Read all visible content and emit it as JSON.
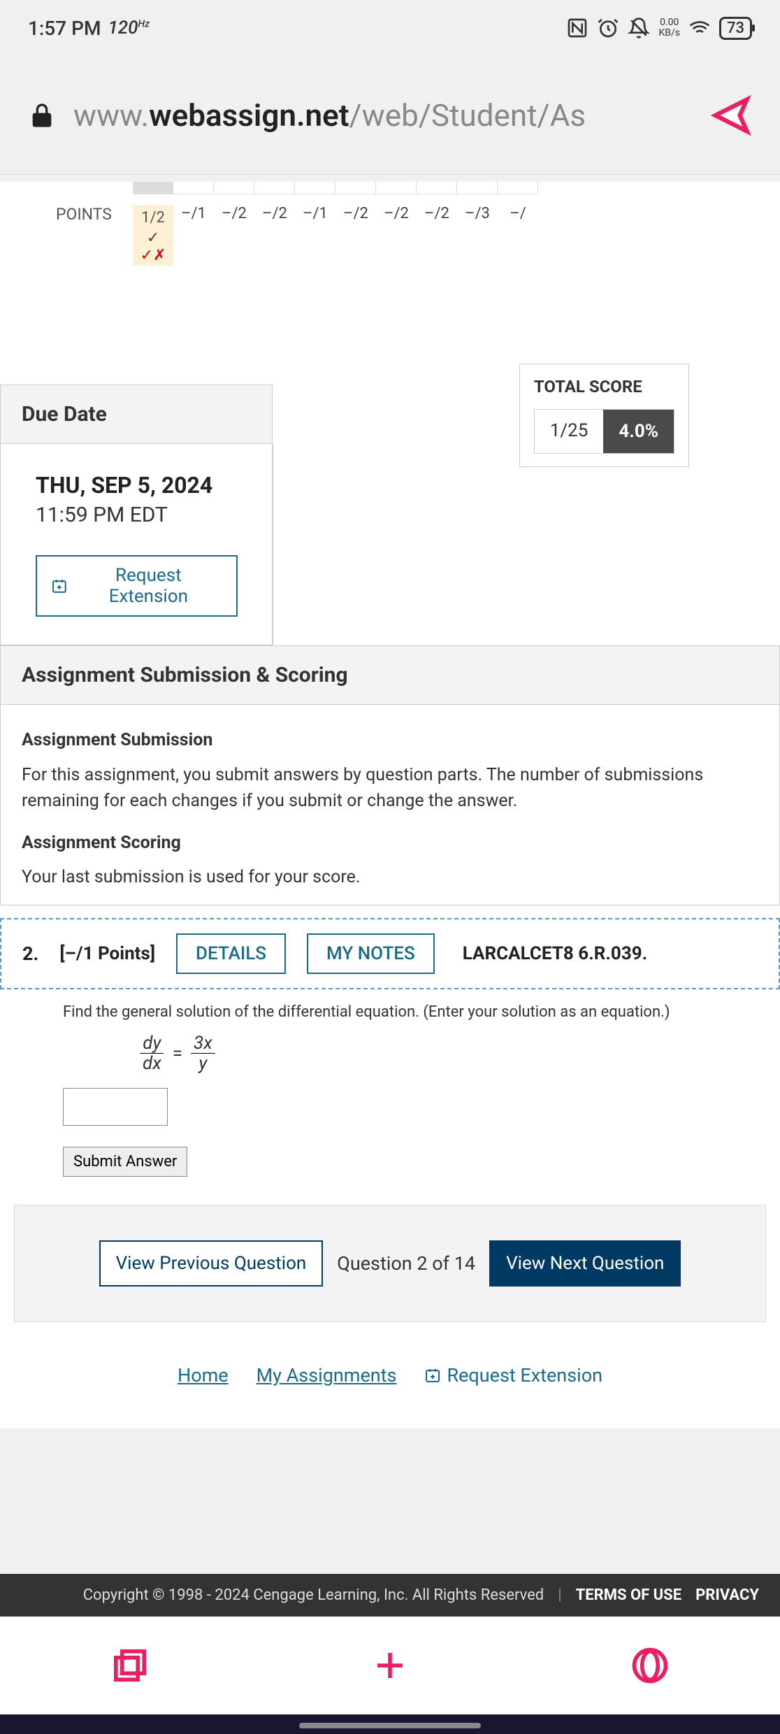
{
  "status": {
    "time": "1:57 PM",
    "refresh": "120",
    "refresh_unit": "Hz",
    "kbs_val": "0.00",
    "kbs_label": "KB/s",
    "battery": "73"
  },
  "url": {
    "prefix": "www.",
    "domain": "webassign.net",
    "path": "/web/Student/As"
  },
  "points": {
    "label": "POINTS",
    "cells": [
      "1/2",
      "–/1",
      "–/2",
      "–/2",
      "–/1",
      "–/2",
      "–/2",
      "–/2",
      "–/3",
      "–/"
    ]
  },
  "total_score": {
    "label": "TOTAL SCORE",
    "frac": "1/25",
    "pct": "4.0%"
  },
  "due_date": {
    "header": "Due Date",
    "date": "THU, SEP 5, 2024",
    "time": "11:59 PM EDT",
    "ext_btn": "Request Extension"
  },
  "submission": {
    "header": "Assignment Submission & Scoring",
    "sub1": "Assignment Submission",
    "text1": "For this assignment, you submit answers by question parts. The number of submissions remaining for each changes if you submit or change the answer.",
    "sub2": "Assignment Scoring",
    "text2": "Your last submission is used for your score."
  },
  "question": {
    "num": "2.",
    "points": "[–/1 Points]",
    "details": "DETAILS",
    "notes": "MY NOTES",
    "ref": "LARCALCET8 6.R.039.",
    "prompt": "Find the general solution of the differential equation. (Enter your solution as an equation.)",
    "eq_dy": "dy",
    "eq_dx": "dx",
    "eq_eq": "=",
    "eq_3x": "3x",
    "eq_y": "y",
    "submit": "Submit Answer"
  },
  "nav": {
    "prev": "View Previous Question",
    "text": "Question 2 of 14",
    "next": "View Next Question"
  },
  "footer_links": {
    "home": "Home",
    "assignments": "My Assignments",
    "ext": "Request Extension"
  },
  "copyright": {
    "text": "Copyright © 1998 - 2024 Cengage Learning, Inc. All Rights Reserved",
    "terms": "TERMS OF USE",
    "privacy": "PRIVACY"
  }
}
